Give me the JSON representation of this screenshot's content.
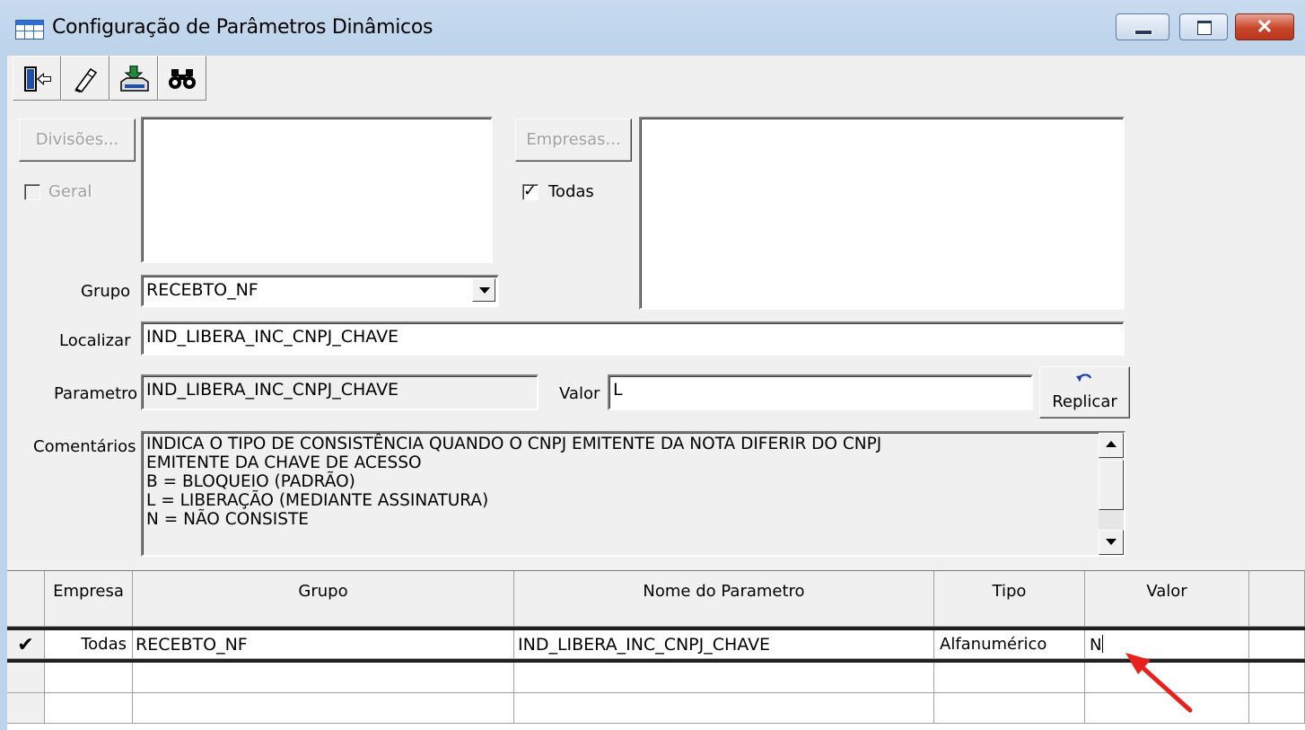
{
  "window": {
    "title": "Configuração de Parâmetros Dinâmicos",
    "close_glyph": "✕"
  },
  "toolbar": {
    "items": [
      {
        "name": "exit-door-icon"
      },
      {
        "name": "eraser-icon"
      },
      {
        "name": "save-download-icon"
      },
      {
        "name": "binoculars-icon"
      }
    ]
  },
  "form": {
    "divisoes_button": "Divisões...",
    "geral_label": "Geral",
    "geral_checked": false,
    "empresas_button": "Empresas...",
    "todas_label": "Todas",
    "todas_checked": true,
    "checkmark": "✓",
    "grupo_label": "Grupo",
    "grupo_value": "RECEBTO_NF",
    "localizar_label": "Localizar",
    "localizar_value": "IND_LIBERA_INC_CNPJ_CHAVE",
    "parametro_label": "Parametro",
    "parametro_value": "IND_LIBERA_INC_CNPJ_CHAVE",
    "valor_label": "Valor",
    "valor_value": "L",
    "replicar_button": "Replicar",
    "comentarios_label": "Comentários",
    "comentarios_text": "INDICA O TIPO DE CONSISTÊNCIA QUANDO O CNPJ EMITENTE DA NOTA DIFERIR DO CNPJ\nEMITENTE DA CHAVE DE ACESSO\nB = BLOQUEIO (PADRÃO)\nL = LIBERAÇÃO (MEDIANTE ASSINATURA)\nN = NÃO CONSISTE"
  },
  "grid": {
    "columns": [
      "Empresa",
      "Grupo",
      "Nome do Parametro",
      "Tipo",
      "Valor"
    ],
    "rows": [
      {
        "indicator": "✔",
        "empresa": "Todas",
        "grupo": "RECEBTO_NF",
        "nome": "IND_LIBERA_INC_CNPJ_CHAVE",
        "tipo": "Alfanumérico",
        "valor": "N"
      }
    ]
  },
  "colors": {
    "annotation_arrow": "#e8211c",
    "titlebar": "#bcd3ea",
    "close_button": "#c8462b"
  }
}
